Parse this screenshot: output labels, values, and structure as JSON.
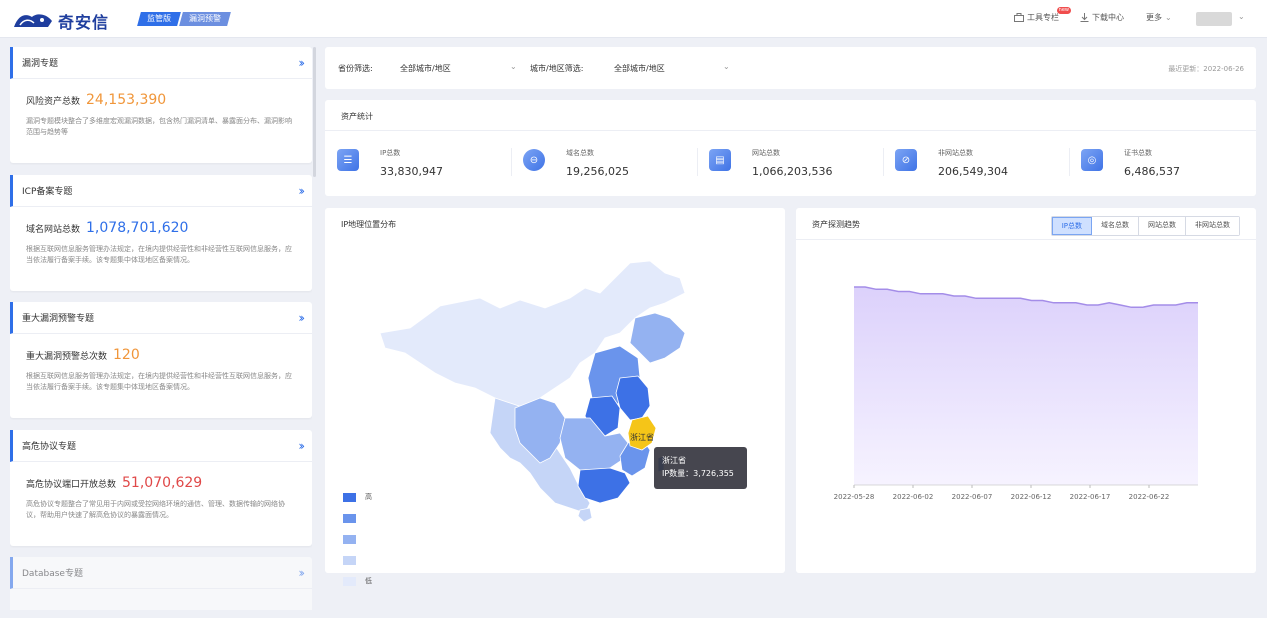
{
  "header": {
    "logo_text": "奇安信",
    "edition_tabs": [
      "监管版",
      "漏洞预警"
    ],
    "toolbar_label": "工具专栏",
    "toolbar_badge": "new",
    "download_label": "下载中心",
    "more_label": "更多"
  },
  "left_cards": [
    {
      "title": "漏洞专题",
      "metric_label": "风险资产总数",
      "metric_value": "24,153,390",
      "desc": "漏洞专题模块整合了多维度宏观漏洞数据，包含热门漏洞清单、暴露面分布、漏洞影响范围与趋势等"
    },
    {
      "title": "ICP备案专题",
      "metric_label": "域名网站总数",
      "metric_value": "1,078,701,620",
      "desc": "根据互联网信息服务管理办法规定，在境内提供经营性和非经营性互联网信息服务，应当依法履行备案手续。该专题集中体现地区备案情况。"
    },
    {
      "title": "重大漏洞预警专题",
      "metric_label": "重大漏洞预警总次数",
      "metric_value": "120",
      "desc": "根据互联网信息服务管理办法规定，在境内提供经营性和非经营性互联网信息服务，应当依法履行备案手续。该专题集中体现地区备案情况。"
    },
    {
      "title": "高危协议专题",
      "metric_label": "高危协议端口开放总数",
      "metric_value": "51,070,629",
      "desc": "高危协议专题整合了常见用于内网或受控网络环境的通信、管理、数据传输的网络协议，帮助用户快速了解高危协议的暴露面情况。"
    },
    {
      "title": "Database专题"
    }
  ],
  "filters": {
    "province_label": "省份筛选:",
    "province_value": "全部城市/地区",
    "city_label": "城市/地区筛选:",
    "city_value": "全部城市/地区",
    "last_update": "最近更新：2022-06-26"
  },
  "stats": {
    "title": "资产统计",
    "items": [
      {
        "label": "IP总数",
        "value": "33,830,947",
        "icon": "server-icon"
      },
      {
        "label": "域名总数",
        "value": "19,256,025",
        "icon": "globe-icon"
      },
      {
        "label": "网站总数",
        "value": "1,066,203,536",
        "icon": "website-icon"
      },
      {
        "label": "非网站总数",
        "value": "206,549,304",
        "icon": "non-website-icon"
      },
      {
        "label": "证书总数",
        "value": "6,486,537",
        "icon": "certificate-icon"
      }
    ]
  },
  "map_panel": {
    "title": "IP地理位置分布",
    "legend_high": "高",
    "legend_low": "低",
    "legend_colors": [
      "#3d71e6",
      "#6a94ec",
      "#94b2f1",
      "#c5d5f7",
      "#e3eafb"
    ],
    "highlight_label": "浙江省",
    "tooltip_title": "浙江省",
    "tooltip_value": "IP数量：3,726,355"
  },
  "trend_panel": {
    "title": "资产探测趋势",
    "tabs": [
      "IP总数",
      "域名总数",
      "网站总数",
      "非网站总数"
    ],
    "active_tab": 0
  },
  "chart_data": {
    "type": "area",
    "title": "资产探测趋势",
    "x_ticks": [
      "2022-05-28",
      "2022-06-02",
      "2022-06-07",
      "2022-06-12",
      "2022-06-17",
      "2022-06-22"
    ],
    "series": [
      {
        "name": "IP总数",
        "values": [
          0.88,
          0.88,
          0.87,
          0.87,
          0.86,
          0.86,
          0.85,
          0.85,
          0.85,
          0.84,
          0.84,
          0.83,
          0.83,
          0.83,
          0.83,
          0.83,
          0.82,
          0.82,
          0.81,
          0.81,
          0.81,
          0.8,
          0.8,
          0.81,
          0.8,
          0.79,
          0.79,
          0.8,
          0.8,
          0.8,
          0.81,
          0.81
        ]
      }
    ],
    "grid": false,
    "colors": {
      "line": "#a48de8",
      "fill_top": "#dcd1fb",
      "fill_bottom": "#f6f3ff"
    }
  }
}
